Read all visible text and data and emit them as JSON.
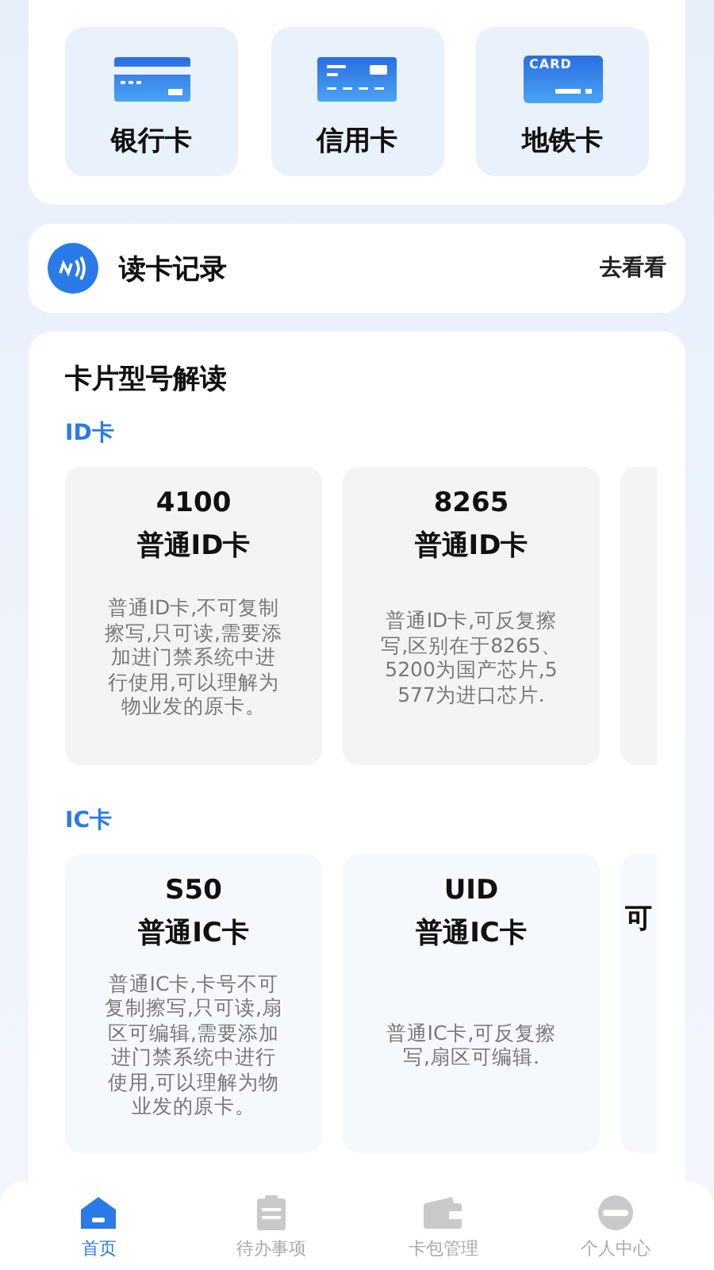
{
  "quick_cards": [
    {
      "label": "银行卡",
      "kind": "bank"
    },
    {
      "label": "信用卡",
      "kind": "credit"
    },
    {
      "label": "地铁卡",
      "kind": "metro",
      "badge": "CARD"
    }
  ],
  "record": {
    "title": "读卡记录",
    "action": "去看看"
  },
  "guide": {
    "title": "卡片型号解读",
    "sections": [
      {
        "heading": "ID卡",
        "cards": [
          {
            "model": "4100",
            "type": "普通ID卡",
            "description": "普通ID卡,不可复制擦写,只可读,需要添加进门禁系统中进行使用,可以理解为物业发的原卡。"
          },
          {
            "model": "8265",
            "type": "普通ID卡",
            "description": "普通ID卡,可反复擦写,区别在于8265、5200为国产芯片,5577为进口芯片."
          }
        ],
        "peek": {
          "kind": "card"
        }
      },
      {
        "heading": "IC卡",
        "cards": [
          {
            "model": "S50",
            "type": "普通IC卡",
            "description": "普通IC卡,卡号不可复制擦写,只可读,扇区可编辑,需要添加进门禁系统中进行使用,可以理解为物业发的原卡。"
          },
          {
            "model": "UID",
            "type": "普通IC卡",
            "description": "普通IC卡,可反复擦写,扇区可编辑."
          }
        ],
        "peek": {
          "kind": "card",
          "title": "可"
        }
      }
    ]
  },
  "tab_bar": [
    {
      "label": "首页",
      "kind": "home",
      "selected": true
    },
    {
      "label": "待办事项",
      "kind": "clipboard",
      "selected": false
    },
    {
      "label": "卡包管理",
      "kind": "wallet",
      "selected": false
    },
    {
      "label": "个人中心",
      "kind": "person",
      "selected": false
    }
  ]
}
